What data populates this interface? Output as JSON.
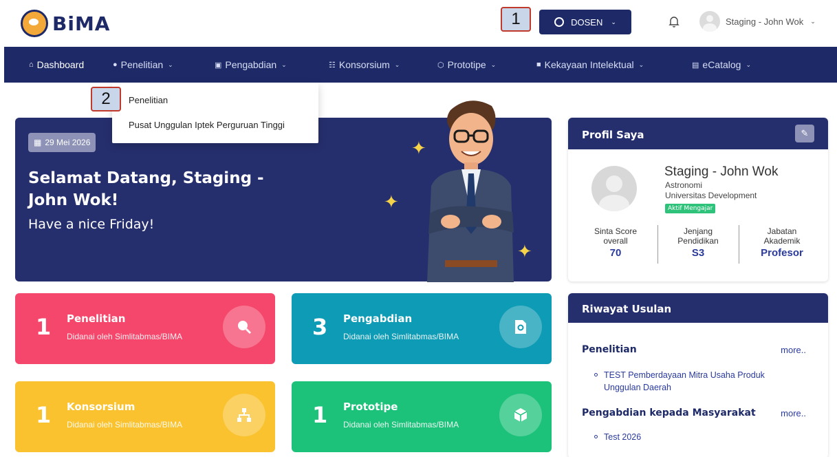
{
  "header": {
    "logo_text": "BiMA",
    "role_label": "DOSEN",
    "user_name": "Staging - John Wok"
  },
  "annotations": {
    "badge1": "1",
    "badge2": "2"
  },
  "nav": {
    "items": [
      {
        "label": "Dashboard",
        "icon": "home-icon"
      },
      {
        "label": "Penelitian",
        "icon": "search-icon"
      },
      {
        "label": "Pengabdian",
        "icon": "document-icon"
      },
      {
        "label": "Konsorsium",
        "icon": "hierarchy-icon"
      },
      {
        "label": "Prototipe",
        "icon": "cube-icon"
      },
      {
        "label": "Kekayaan Intelektual",
        "icon": "lock-icon"
      },
      {
        "label": "eCatalog",
        "icon": "file-icon"
      }
    ]
  },
  "dropdown": {
    "items": [
      "Penelitian",
      "Pusat Unggulan Iptek Perguruan Tinggi"
    ]
  },
  "welcome": {
    "date": "29 Mei 2026",
    "title": "Selamat Datang, Staging - John Wok!",
    "subtitle": "Have a nice Friday!"
  },
  "stats": [
    {
      "count": "1",
      "title": "Penelitian",
      "subtitle": "Didanai oleh Simlitabmas/BIMA",
      "color": "#f5476b",
      "icon": "search-icon"
    },
    {
      "count": "3",
      "title": "Pengabdian",
      "subtitle": "Didanai oleh Simlitabmas/BIMA",
      "color": "#0e9bb5",
      "icon": "document-search-icon"
    },
    {
      "count": "1",
      "title": "Konsorsium",
      "subtitle": "Didanai oleh Simlitabmas/BIMA",
      "color": "#f9c22e",
      "icon": "hierarchy-icon"
    },
    {
      "count": "1",
      "title": "Prototipe",
      "subtitle": "Didanai oleh Simlitabmas/BIMA",
      "color": "#1dc27a",
      "icon": "cube-icon"
    }
  ],
  "profile": {
    "heading": "Profil Saya",
    "name": "Staging - John Wok",
    "field": "Astronomi",
    "university": "Universitas Development",
    "status": "Aktif Mengajar",
    "metrics": [
      {
        "label1": "Sinta Score",
        "label2": "overall",
        "value": "70"
      },
      {
        "label1": "Jenjang",
        "label2": "Pendidikan",
        "value": "S3"
      },
      {
        "label1": "Jabatan",
        "label2": "Akademik",
        "value": "Profesor"
      }
    ]
  },
  "riwayat": {
    "heading": "Riwayat Usulan",
    "sections": [
      {
        "title": "Penelitian",
        "more": "more..",
        "items": [
          "TEST Pemberdayaan Mitra Usaha Produk Unggulan Daerah"
        ]
      },
      {
        "title": "Pengabdian kepada Masyarakat",
        "more": "more..",
        "items": [
          "Test 2026"
        ]
      }
    ]
  },
  "colors": {
    "primary": "#1e2a68",
    "card_bg": "#262f6e",
    "accent_link": "#2a3a9c"
  }
}
